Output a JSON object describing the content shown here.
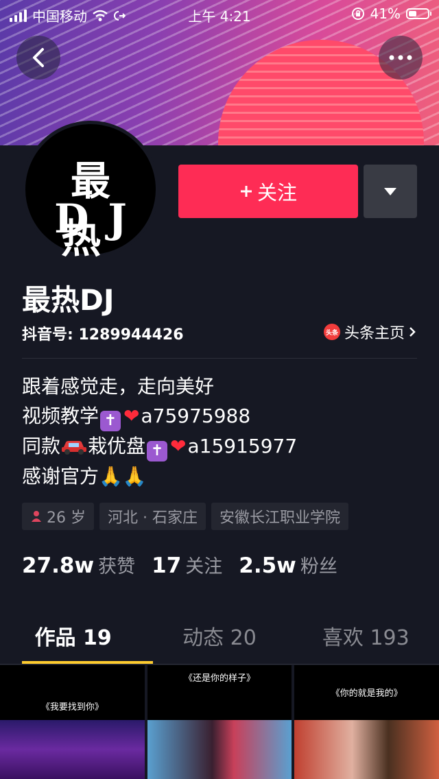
{
  "status_bar": {
    "carrier": "中国移动",
    "time": "上午 4:21",
    "battery": "41%"
  },
  "profile": {
    "avatar_text_line1": "最热",
    "avatar_text_line2": "DJ",
    "follow_label": "关注",
    "name": "最热DJ",
    "douyin_id": "抖音号: 1289944426",
    "toutiao_badge": "头条",
    "toutiao_link": "头条主页"
  },
  "bio": {
    "line1": "跟着感觉走，走向美好",
    "line2_prefix": "视频教学",
    "line2_suffix": "a75975988",
    "line3_prefix": "同款",
    "line3_mid": "栽优盘",
    "line3_suffix": "a15915977",
    "line4": "感谢官方🙏🙏"
  },
  "tags": {
    "age": "26 岁",
    "location": "河北 · 石家庄",
    "school": "安徽长江职业学院"
  },
  "stats": {
    "likes_value": "27.8w",
    "likes_label": "获赞",
    "following_value": "17",
    "following_label": "关注",
    "followers_value": "2.5w",
    "followers_label": "粉丝"
  },
  "tabs": [
    {
      "label": "作品 19"
    },
    {
      "label": "动态 20"
    },
    {
      "label": "喜欢 193"
    }
  ],
  "videos": [
    {
      "caption": "《我要找到你》"
    },
    {
      "caption": "《还是你的样子》"
    },
    {
      "caption": "《你的就是我的》"
    }
  ],
  "colors": {
    "background": "#161823",
    "accent_follow": "#fe2c55",
    "tab_indicator": "#fecc2f"
  }
}
